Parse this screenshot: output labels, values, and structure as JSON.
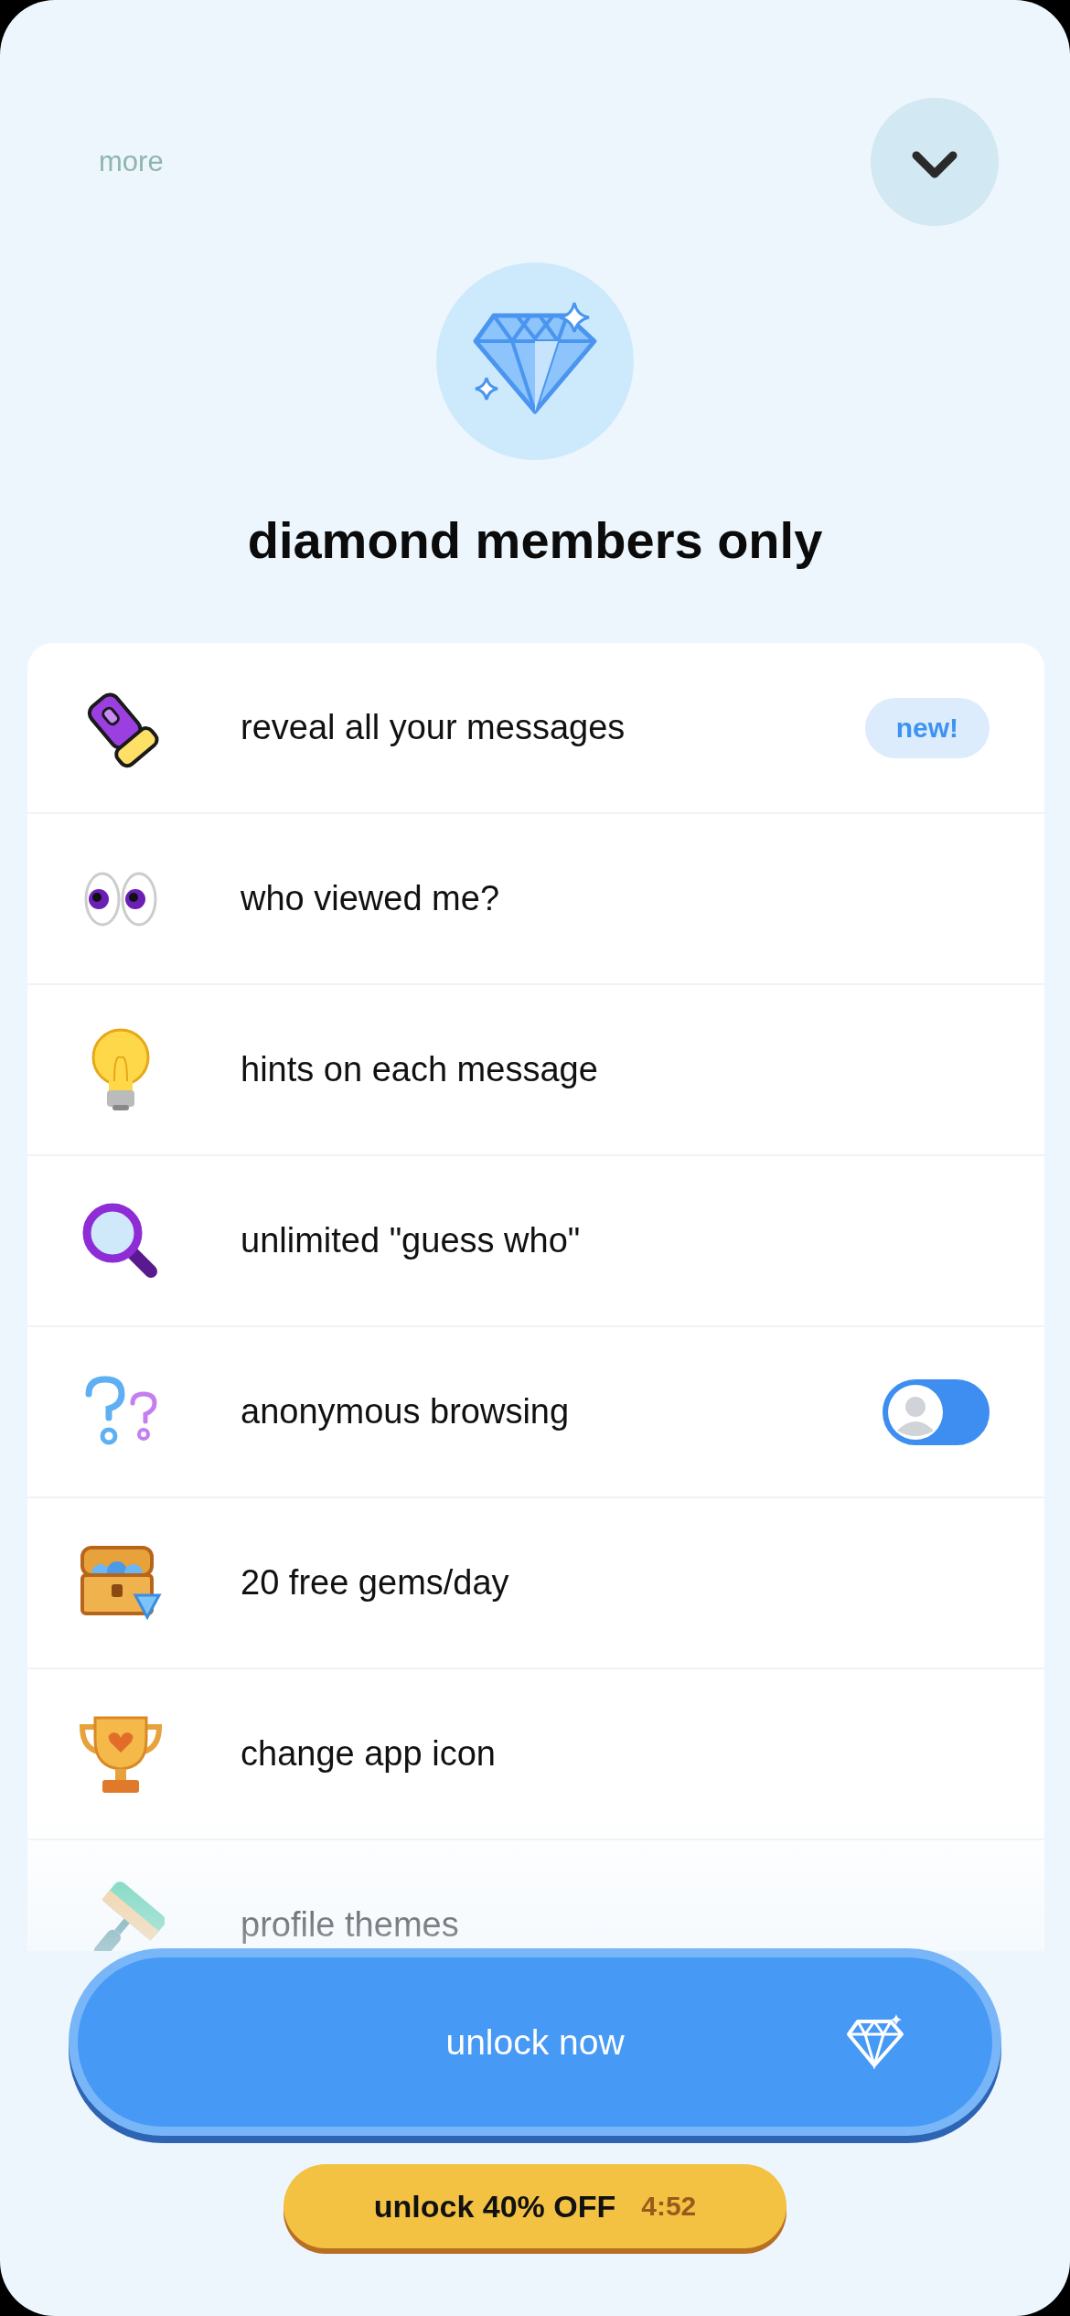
{
  "header": {
    "more_label": "more"
  },
  "title": "diamond members only",
  "features": [
    {
      "label": "reveal all your messages",
      "badge": "new!"
    },
    {
      "label": "who viewed me?"
    },
    {
      "label": "hints on each message"
    },
    {
      "label": "unlimited \"guess who\""
    },
    {
      "label": "anonymous browsing",
      "toggle": {
        "on": true
      }
    },
    {
      "label": "20 free gems/day"
    },
    {
      "label": "change app icon"
    },
    {
      "label": "profile themes"
    }
  ],
  "unlock_button": {
    "label": "unlock now"
  },
  "discount_button": {
    "label": "unlock 40% OFF",
    "timer": "4:52"
  }
}
